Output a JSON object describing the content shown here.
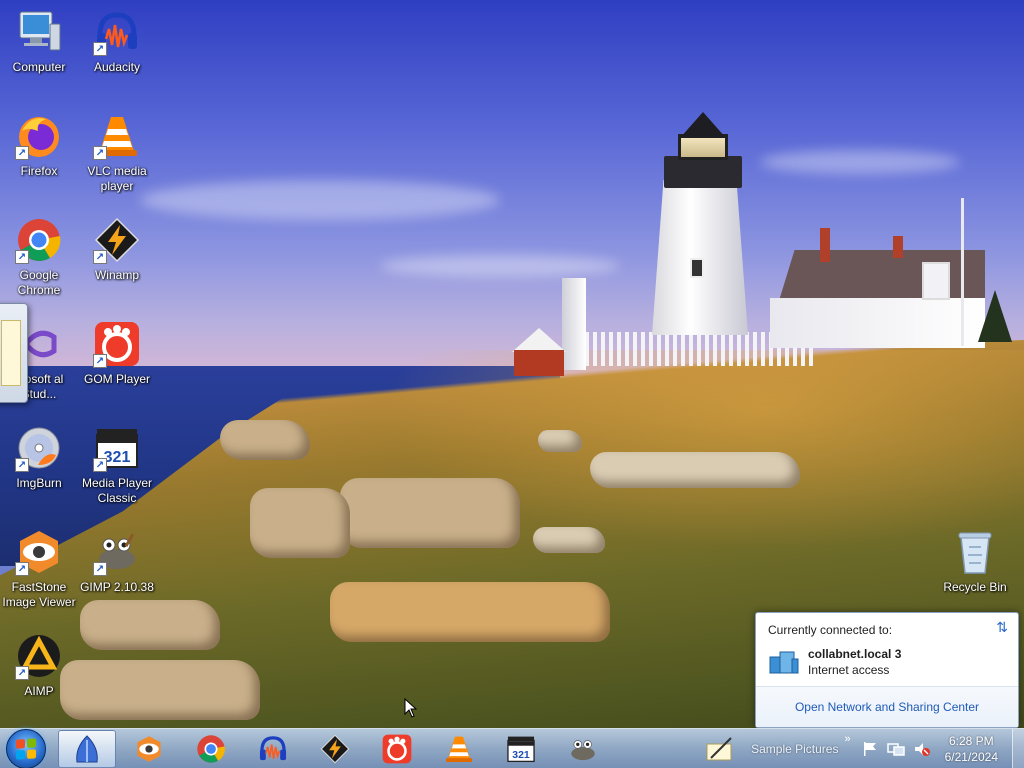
{
  "desktop": {
    "icons": [
      {
        "id": "computer",
        "label": "Computer",
        "icon": "computer-icon",
        "shortcut": false
      },
      {
        "id": "audacity",
        "label": "Audacity",
        "icon": "audacity-icon",
        "shortcut": true
      },
      {
        "id": "firefox",
        "label": "Firefox",
        "icon": "firefox-icon",
        "shortcut": true
      },
      {
        "id": "vlc",
        "label": "VLC media player",
        "icon": "vlc-icon",
        "shortcut": true
      },
      {
        "id": "chrome",
        "label": "Google Chrome",
        "icon": "chrome-icon",
        "shortcut": true
      },
      {
        "id": "winamp",
        "label": "Winamp",
        "icon": "winamp-icon",
        "shortcut": true
      },
      {
        "id": "vs",
        "label": "crosoft al Stud...",
        "icon": "visual-studio-icon",
        "shortcut": true
      },
      {
        "id": "gom",
        "label": "GOM Player",
        "icon": "gom-player-icon",
        "shortcut": true
      },
      {
        "id": "imgburn",
        "label": "ImgBurn",
        "icon": "imgburn-icon",
        "shortcut": true
      },
      {
        "id": "mpc",
        "label": "Media Player Classic",
        "icon": "media-player-classic-icon",
        "shortcut": true
      },
      {
        "id": "faststone",
        "label": "FastStone Image Viewer",
        "icon": "faststone-icon",
        "shortcut": true
      },
      {
        "id": "gimp",
        "label": "GIMP 2.10.38",
        "icon": "gimp-icon",
        "shortcut": true
      },
      {
        "id": "aimp",
        "label": "AIMP",
        "icon": "aimp-icon",
        "shortcut": true
      },
      {
        "id": "recycle",
        "label": "Recycle Bin",
        "icon": "recycle-bin-icon",
        "shortcut": false
      }
    ]
  },
  "network_popup": {
    "heading": "Currently connected to:",
    "network_name": "collabnet.local  3",
    "access": "Internet access",
    "link": "Open Network and Sharing Center"
  },
  "taskbar": {
    "apps": [
      {
        "name": "show-desktop-app",
        "icon": "blue-shell-icon",
        "active": true
      },
      {
        "name": "faststone",
        "icon": "faststone-icon",
        "active": false
      },
      {
        "name": "chrome",
        "icon": "chrome-icon",
        "active": false
      },
      {
        "name": "audacity",
        "icon": "audacity-icon",
        "active": false
      },
      {
        "name": "winamp",
        "icon": "winamp-icon",
        "active": false
      },
      {
        "name": "gom",
        "icon": "gom-player-icon",
        "active": false
      },
      {
        "name": "vlc",
        "icon": "vlc-icon",
        "active": false
      },
      {
        "name": "mpc",
        "icon": "media-player-classic-icon",
        "active": false
      },
      {
        "name": "gimp",
        "icon": "gimp-icon",
        "active": false
      }
    ],
    "toolbar_label": "Sample Pictures",
    "chevron": "»",
    "clock": {
      "time": "6:28 PM",
      "date": "6/21/2024"
    }
  },
  "colors": {
    "taskbar_top": "#bed2eb",
    "link_blue": "#1f5bb8",
    "chrome_red": "#db4437",
    "chrome_green": "#0f9d58",
    "chrome_yellow": "#f4b400",
    "chrome_blue": "#4285f4"
  }
}
